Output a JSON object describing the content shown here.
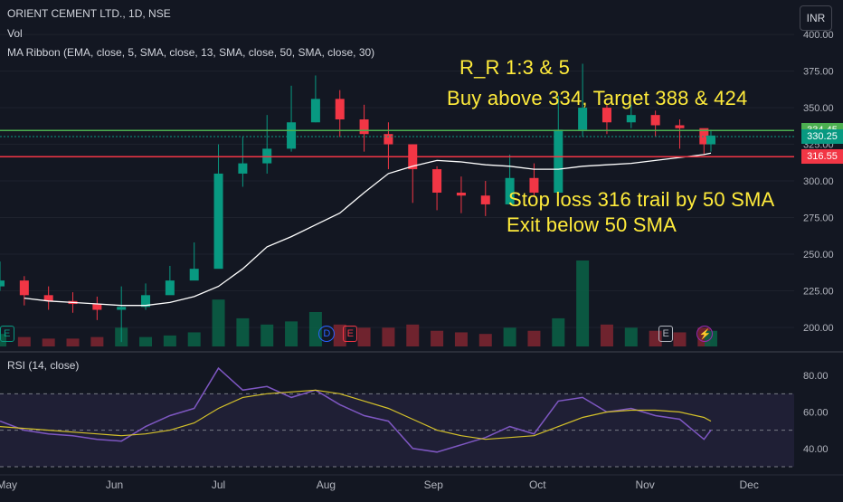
{
  "header": {
    "symbol_line": "ORIENT CEMENT LTD., 1D, NSE",
    "vol_label": "Vol",
    "ma_label": "MA Ribbon (EMA, close, 5, SMA, close, 13, SMA, close, 50, SMA, close, 30)",
    "currency": "INR"
  },
  "rsi_panel": {
    "label": "RSI (14, close)"
  },
  "annotations": {
    "rr": "R_R 1:3 & 5",
    "buy": "Buy above 334, Target 388 & 424",
    "stop": "Stop loss 316 trail by 50 SMA",
    "exit": "Exit below 50 SMA"
  },
  "events": [
    {
      "label": "E",
      "type": "earnings",
      "x": "2024-05-01",
      "color": "#089981"
    },
    {
      "label": "D",
      "type": "dividend",
      "x": "2024-08-01",
      "color": "#2962ff"
    },
    {
      "label": "E",
      "type": "earnings",
      "x": "2024-08-08",
      "color": "#f23645"
    },
    {
      "label": "E",
      "type": "earnings",
      "x": "2024-11-07",
      "color": "#b2b5be"
    },
    {
      "label": "⚡",
      "type": "event",
      "x": "2024-11-18",
      "color": "#9c27b0"
    }
  ],
  "chart_data": [
    {
      "type": "candlestick",
      "title": "ORIENT CEMENT LTD., 1D, NSE",
      "ylim": [
        187,
        405
      ],
      "yticks": [
        200,
        225,
        250,
        275,
        300,
        325,
        350,
        375,
        400
      ],
      "ytick_labels": [
        "200.00",
        "225.00",
        "250.00",
        "275.00",
        "300.00",
        "325.00",
        "350.00",
        "375.00",
        "400.00"
      ],
      "x_dates": [
        "2024-04-29",
        "2024-05-06",
        "2024-05-13",
        "2024-05-20",
        "2024-05-27",
        "2024-06-03",
        "2024-06-10",
        "2024-06-17",
        "2024-06-24",
        "2024-07-01",
        "2024-07-08",
        "2024-07-15",
        "2024-07-22",
        "2024-07-29",
        "2024-08-05",
        "2024-08-12",
        "2024-08-19",
        "2024-08-26",
        "2024-09-02",
        "2024-09-09",
        "2024-09-16",
        "2024-09-23",
        "2024-09-30",
        "2024-10-07",
        "2024-10-14",
        "2024-10-21",
        "2024-10-28",
        "2024-11-04",
        "2024-11-11",
        "2024-11-18",
        "2024-11-20"
      ],
      "close": [
        232,
        222,
        218,
        216,
        212,
        214,
        222,
        232,
        240,
        305,
        312,
        322,
        340,
        356,
        342,
        332,
        325,
        308,
        292,
        290,
        284,
        302,
        292,
        335,
        350,
        340,
        345,
        338,
        336,
        325,
        331
      ],
      "high": [
        245,
        235,
        228,
        224,
        221,
        228,
        230,
        242,
        258,
        325,
        330,
        345,
        365,
        372,
        362,
        352,
        340,
        325,
        310,
        303,
        300,
        318,
        312,
        358,
        380,
        352,
        352,
        348,
        342,
        334,
        335
      ],
      "low": [
        225,
        215,
        212,
        210,
        205,
        190,
        212,
        224,
        235,
        250,
        296,
        305,
        320,
        340,
        330,
        320,
        308,
        285,
        280,
        278,
        276,
        285,
        290,
        305,
        330,
        332,
        336,
        330,
        322,
        318,
        320
      ],
      "sma50": [
        null,
        220,
        218,
        217,
        216,
        215,
        215,
        217,
        221,
        228,
        240,
        255,
        262,
        270,
        278,
        292,
        305,
        310,
        314,
        313,
        311,
        310,
        308,
        308,
        310,
        311,
        312,
        314,
        316,
        318,
        319
      ],
      "volume": [
        8,
        6,
        5,
        5,
        6,
        12,
        6,
        7,
        9,
        30,
        18,
        14,
        16,
        22,
        14,
        12,
        12,
        14,
        10,
        9,
        8,
        12,
        10,
        18,
        55,
        14,
        12,
        10,
        9,
        12,
        10
      ],
      "levels": [
        {
          "label": "334.45",
          "y": 334.45,
          "color": "#4caf50"
        },
        {
          "label": "330.25",
          "y": 330.25,
          "color": "#089981"
        },
        {
          "label": "316.55",
          "y": 316.55,
          "color": "#f23645"
        }
      ]
    },
    {
      "type": "line",
      "title": "RSI (14, close)",
      "ylim": [
        28,
        90
      ],
      "yticks": [
        40,
        60,
        80
      ],
      "ytick_labels": [
        "40.00",
        "60.00",
        "80.00"
      ],
      "band": [
        30,
        70
      ],
      "mid": 50,
      "x_dates": [
        "2024-04-29",
        "2024-05-06",
        "2024-05-13",
        "2024-05-20",
        "2024-05-27",
        "2024-06-03",
        "2024-06-10",
        "2024-06-17",
        "2024-06-24",
        "2024-07-01",
        "2024-07-08",
        "2024-07-15",
        "2024-07-22",
        "2024-07-29",
        "2024-08-05",
        "2024-08-12",
        "2024-08-19",
        "2024-08-26",
        "2024-09-02",
        "2024-09-09",
        "2024-09-16",
        "2024-09-23",
        "2024-09-30",
        "2024-10-07",
        "2024-10-14",
        "2024-10-21",
        "2024-10-28",
        "2024-11-04",
        "2024-11-11",
        "2024-11-18",
        "2024-11-20"
      ],
      "rsi": [
        55,
        50,
        48,
        47,
        45,
        44,
        52,
        58,
        62,
        84,
        72,
        74,
        68,
        72,
        64,
        58,
        55,
        40,
        38,
        42,
        46,
        52,
        48,
        66,
        68,
        60,
        62,
        58,
        56,
        45,
        50
      ],
      "rsi_ma": [
        52,
        51,
        50,
        49,
        48,
        47,
        48,
        50,
        54,
        62,
        68,
        70,
        71,
        72,
        70,
        66,
        62,
        56,
        50,
        47,
        45,
        46,
        47,
        52,
        57,
        60,
        61,
        61,
        60,
        57,
        55
      ]
    }
  ],
  "x_axis": {
    "labels": [
      "May",
      "Jun",
      "Jul",
      "Aug",
      "Sep",
      "Oct",
      "Nov",
      "Dec"
    ],
    "dates": [
      "2024-05-01",
      "2024-06-01",
      "2024-07-01",
      "2024-08-01",
      "2024-09-01",
      "2024-10-01",
      "2024-11-01",
      "2024-12-01"
    ]
  },
  "colors": {
    "up": "#089981",
    "down": "#f23645",
    "sma": "#ffffff",
    "rsi": "#7e57c2",
    "rsi_ma": "#d4c12a",
    "grid": "#1e222d"
  }
}
